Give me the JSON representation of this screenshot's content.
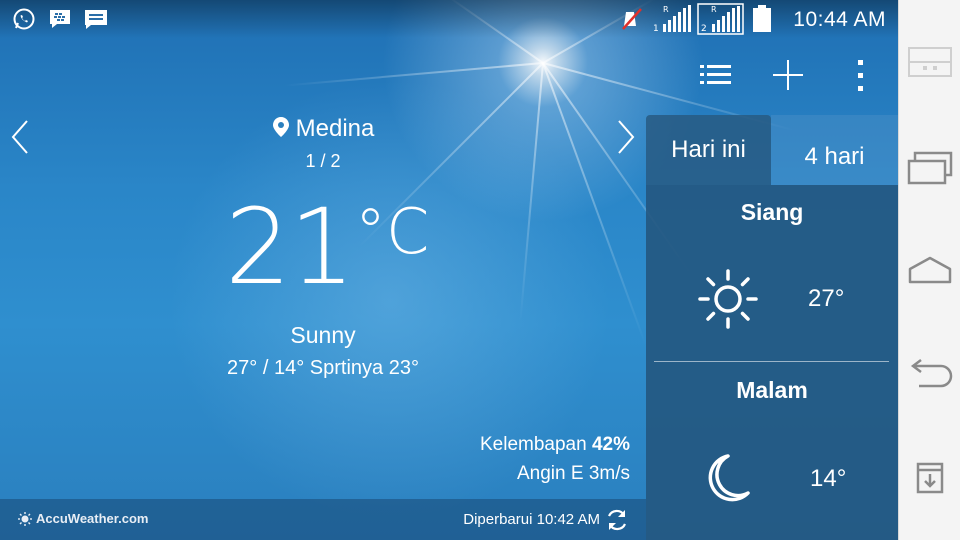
{
  "status_bar": {
    "notifications": [
      "whatsapp-icon",
      "bbm-icon",
      "message-icon"
    ],
    "indicators": [
      "muted-icon",
      "signal-sim1-icon",
      "signal-sim2-icon",
      "battery-icon"
    ],
    "clock": "10:44 AM"
  },
  "action_bar": {
    "buttons": [
      "list-icon",
      "add-icon",
      "more-vert-icon"
    ]
  },
  "weather": {
    "location": "Medina",
    "page_indicator": "1 / 2",
    "temperature": "21",
    "unit": "°C",
    "condition": "Sunny",
    "minmax": "27° / 14°",
    "feels_like": "Sprtinya 23°",
    "humidity_label": "Kelembapan",
    "humidity_value": "42%",
    "wind": "Angin E 3m/s"
  },
  "footer": {
    "brand": "AccuWeather.com",
    "updated": "Diperbarui 10:42 AM"
  },
  "forecast_panel": {
    "tabs": [
      {
        "label": "Hari ini",
        "active": true
      },
      {
        "label": "4 hari",
        "active": false
      }
    ],
    "day": {
      "label": "Siang",
      "temp": "27°",
      "icon": "sun-icon"
    },
    "night": {
      "label": "Malam",
      "temp": "14°",
      "icon": "moon-icon"
    }
  },
  "nav_bar": {
    "buttons": [
      "dual-window-icon",
      "recent-apps-icon",
      "home-icon",
      "back-icon",
      "notes-icon"
    ]
  },
  "colors": {
    "sky": "#2f8fcf",
    "panel": "#23557d",
    "nav_bar": "#f4f4f4"
  }
}
